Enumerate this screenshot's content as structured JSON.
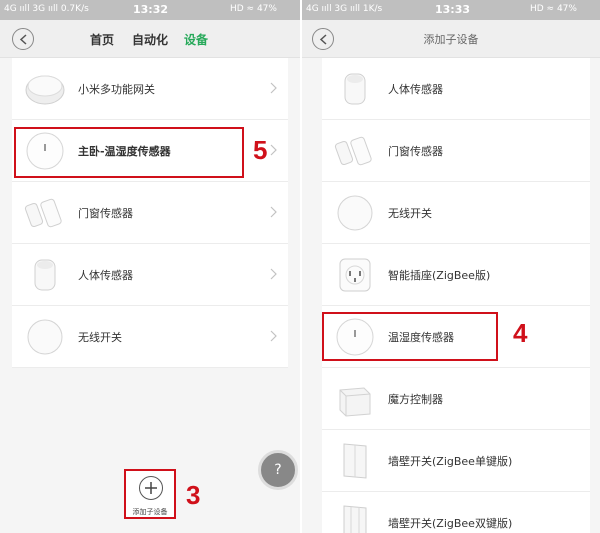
{
  "left": {
    "status": {
      "network": "4G ııll 3G ııll 0.7K/s",
      "time": "13:32",
      "indicators": "HD ≈ 47%"
    },
    "nav": {
      "tabs": [
        "首页",
        "自动化",
        "设备"
      ],
      "active_tab": "设备"
    },
    "devices": [
      {
        "label": "小米多功能网关",
        "icon": "gateway-icon"
      },
      {
        "label": "主卧-温湿度传感器",
        "icon": "temp-humidity-sensor-icon"
      },
      {
        "label": "门窗传感器",
        "icon": "door-window-sensor-icon"
      },
      {
        "label": "人体传感器",
        "icon": "motion-sensor-icon"
      },
      {
        "label": "无线开关",
        "icon": "wireless-switch-icon"
      }
    ],
    "add_button": {
      "caption": "添加子设备",
      "icon": "plus-icon"
    },
    "help": {
      "label": "?"
    },
    "annotations": {
      "step_5": "5",
      "step_3": "3"
    }
  },
  "right": {
    "status": {
      "network": "4G ııll 3G ııll 1K/s",
      "time": "13:33",
      "indicators": "HD ≈ 47%"
    },
    "nav": {
      "title": "添加子设备"
    },
    "devices": [
      {
        "label": "人体传感器",
        "icon": "motion-sensor-icon"
      },
      {
        "label": "门窗传感器",
        "icon": "door-window-sensor-icon"
      },
      {
        "label": "无线开关",
        "icon": "wireless-switch-icon"
      },
      {
        "label": "智能插座(ZigBee版)",
        "icon": "smart-plug-icon"
      },
      {
        "label": "温湿度传感器",
        "icon": "temp-humidity-sensor-icon"
      },
      {
        "label": "魔方控制器",
        "icon": "magic-cube-icon"
      },
      {
        "label": "墙壁开关(ZigBee单键版)",
        "icon": "wall-switch-single-icon"
      },
      {
        "label": "墙壁开关(ZigBee双键版)",
        "icon": "wall-switch-double-icon"
      }
    ],
    "annotations": {
      "step_4": "4"
    }
  },
  "colors": {
    "accent": "#27a95a",
    "annotation": "#d0101a"
  }
}
